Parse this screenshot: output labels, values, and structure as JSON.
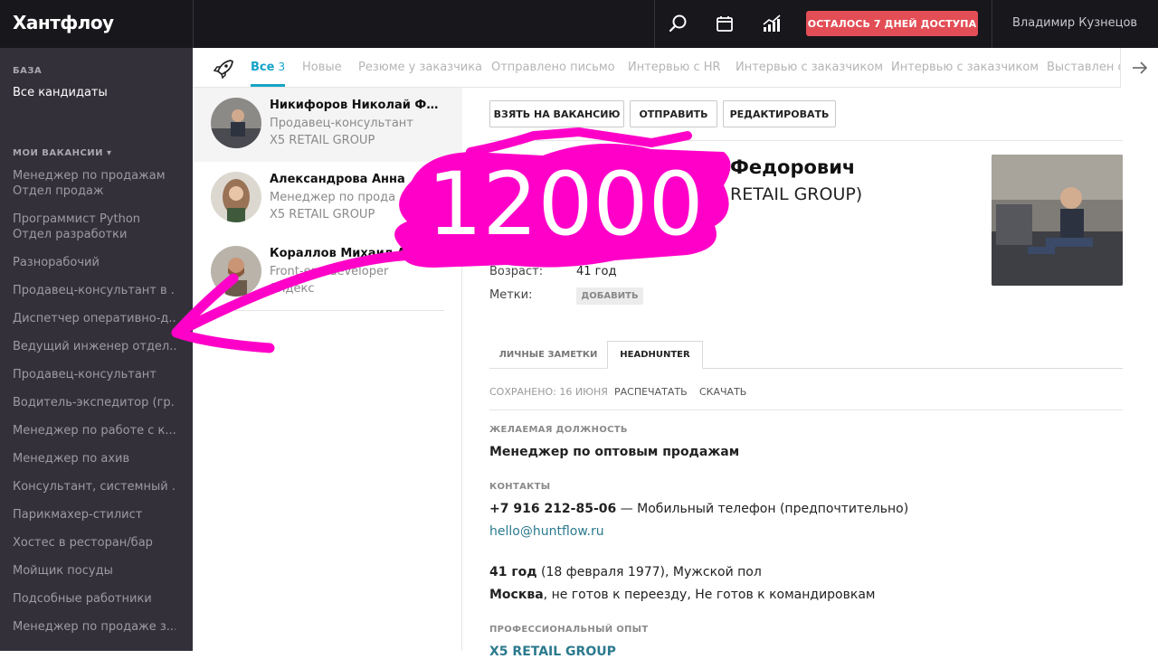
{
  "app": {
    "logo": "Хантфлоу",
    "trial_button": "ОСТАЛОСЬ 7 ДНЕЙ ДОСТУПА",
    "user_name": "Владимир Кузнецов"
  },
  "sidebar": {
    "section_base": "БАЗА",
    "all_candidates": "Все кандидаты",
    "section_vacancies": "МОИ ВАКАНСИИ ▾",
    "vacancies": [
      {
        "label": "Менеджер по продажам",
        "sub": "Отдел продаж"
      },
      {
        "label": "Программист Python",
        "sub": "Отдел разработки"
      },
      {
        "label": "Разнорабочий"
      },
      {
        "label": "Продавец-консультант в ..."
      },
      {
        "label": "Диспетчер оперативно-д..."
      },
      {
        "label": "Ведущий инженер отдел..."
      },
      {
        "label": "Продавец-консультант"
      },
      {
        "label": "Водитель-экспедитор (гр..."
      },
      {
        "label": "Менеджер по работе с к..."
      },
      {
        "label": "Менеджер по ахив"
      },
      {
        "label": "Консультант, системный ..."
      },
      {
        "label": "Парикмахер-стилист"
      },
      {
        "label": "Хостес в ресторан/бар"
      },
      {
        "label": "Мойщик посуды"
      },
      {
        "label": "Подсобные работники"
      },
      {
        "label": "Менеджер по продаже з..."
      }
    ]
  },
  "status_tabs": [
    {
      "label": "Все",
      "count": "3",
      "active": true
    },
    {
      "label": "Новые"
    },
    {
      "label": "Резюме у заказчика"
    },
    {
      "label": "Отправлено письмо"
    },
    {
      "label": "Интервью с HR"
    },
    {
      "label": "Интервью с заказчиком"
    },
    {
      "label": "Интервью с заказчиком"
    },
    {
      "label": "Выставлен о"
    }
  ],
  "candidates": [
    {
      "name": "Никифоров Николай Федо...",
      "position": "Продавец-консультант",
      "company": "X5 RETAIL GROUP",
      "selected": true
    },
    {
      "name": "Александрова Анна",
      "position": "Менеджер по прода",
      "company": "X5 RETAIL GROUP"
    },
    {
      "name": "Кораллов Михаил А",
      "position": "Front-end developer",
      "company": "Яндекс"
    }
  ],
  "detail": {
    "actions": {
      "take": "ВЗЯТЬ НА ВАКАНСИЮ",
      "send": "ОТПРАВИТЬ",
      "edit": "РЕДАКТИРОВАТЬ"
    },
    "name_visible": "Федорович",
    "company_visible": "RETAIL GROUP)",
    "age_label": "Возраст:",
    "age_value": "41 год",
    "tags_label": "Метки:",
    "add_tag": "ДОБАВИТЬ",
    "tabs": {
      "notes": "ЛИЧНЫЕ ЗАМЕТКИ",
      "hh": "HEADHUNTER"
    },
    "saved": "СОХРАНЕНО: 16 ИЮНЯ",
    "print": "РАСПЕЧАТАТЬ",
    "download": "СКАЧАТЬ",
    "desired_label": "ЖЕЛАЕМАЯ ДОЛЖНОСТЬ",
    "desired_value": "Менеджер по оптовым продажам",
    "contacts_label": "КОНТАКТЫ",
    "phone": "+7 916 212-85-06",
    "phone_note": " — Мобильный телефон (предпочтительно)",
    "email": "hello@huntflow.ru",
    "age_bold": "41 год",
    "age_rest": " (18 февраля 1977), Мужской пол",
    "city_bold": "Москва",
    "city_rest": ", не готов к переезду, Не готов к командировкам",
    "experience_label": "ПРОФЕССИОНАЛЬНЫЙ ОПЫТ",
    "experience_first": "X5 RETAIL GROUP"
  },
  "overlay": {
    "number": "12000",
    "color": "#ff00c8"
  }
}
